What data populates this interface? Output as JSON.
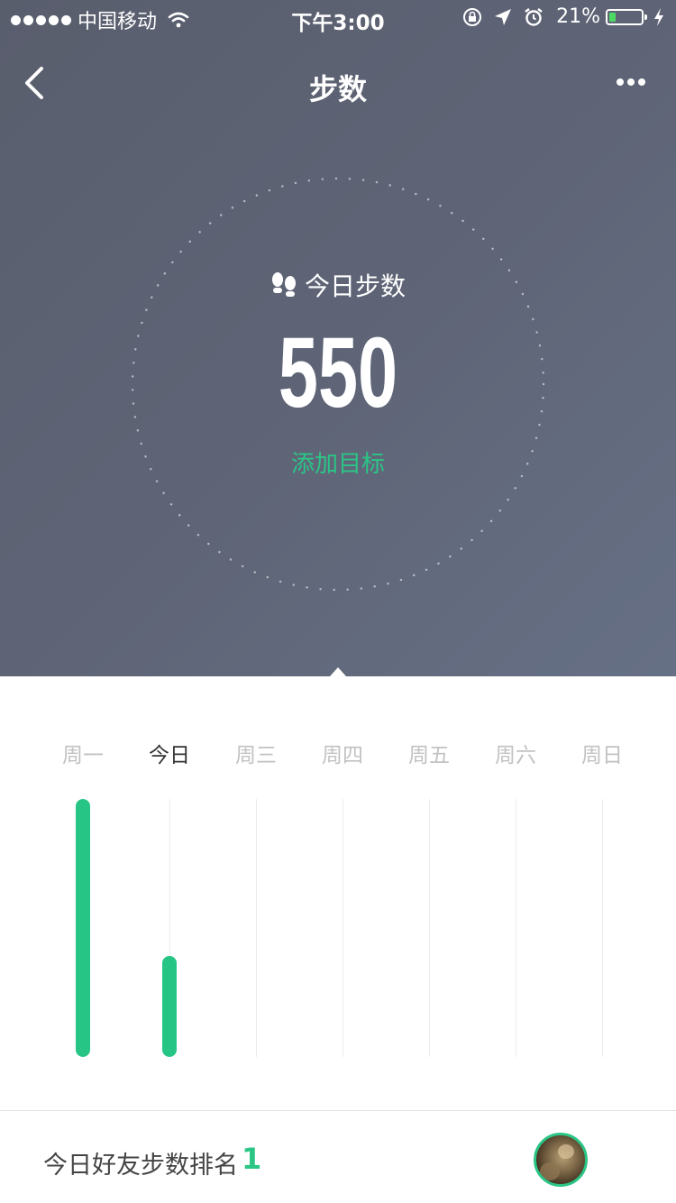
{
  "status_bar": {
    "carrier": "中国移动",
    "time": "下午3:00",
    "battery_percent": "21%",
    "battery_level": 0.21,
    "icons": [
      "signal-dots-icon",
      "wifi-icon",
      "orientation-lock-icon",
      "location-icon",
      "alarm-icon",
      "battery-icon",
      "charging-icon"
    ]
  },
  "nav": {
    "title": "步数",
    "back_icon": "chevron-left-icon",
    "more_icon": "more-dots-icon"
  },
  "summary": {
    "label": "今日步数",
    "label_icon": "footprints-icon",
    "steps": "550",
    "add_goal": "添加目标"
  },
  "week": {
    "days": [
      {
        "label": "周一",
        "active": false
      },
      {
        "label": "今日",
        "active": true
      },
      {
        "label": "周三",
        "active": false
      },
      {
        "label": "周四",
        "active": false
      },
      {
        "label": "周五",
        "active": false
      },
      {
        "label": "周六",
        "active": false
      },
      {
        "label": "周日",
        "active": false
      }
    ]
  },
  "chart_data": {
    "type": "bar",
    "categories": [
      "周一",
      "今日",
      "周三",
      "周四",
      "周五",
      "周六",
      "周日"
    ],
    "values": [
      1400,
      550,
      0,
      0,
      0,
      0,
      0
    ]
  },
  "ranking": {
    "label": "今日好友步数排名",
    "value": "1"
  },
  "colors": {
    "accent": "#26c586",
    "hero_bg": "#5f6577",
    "inactive_day": "#c2c2c2"
  }
}
